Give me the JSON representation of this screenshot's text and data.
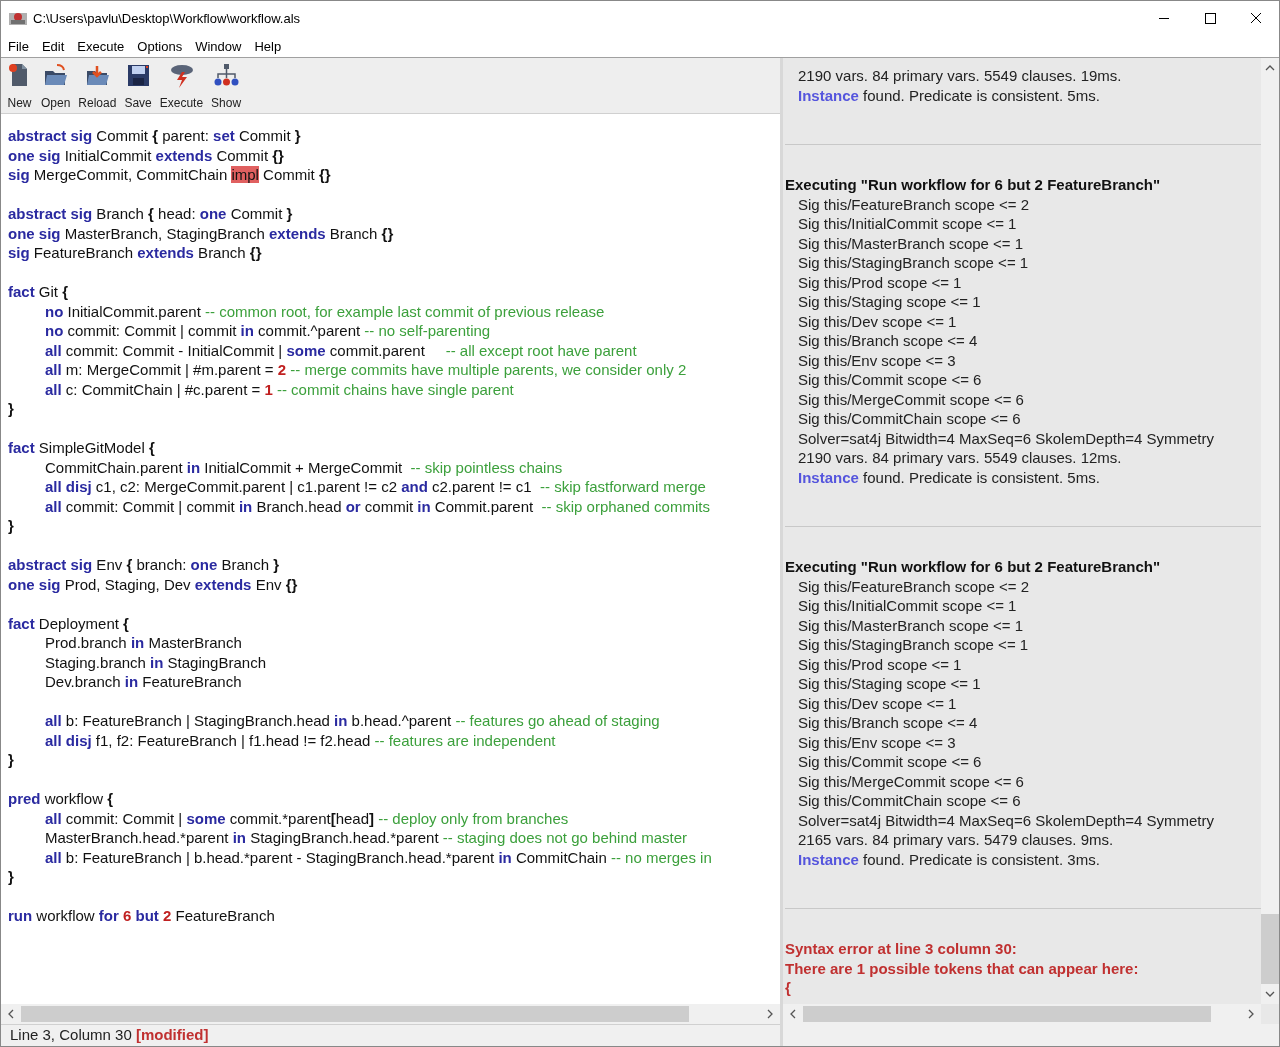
{
  "window": {
    "title": "C:\\Users\\pavlu\\Desktop\\Workflow\\workflow.als"
  },
  "menu": [
    {
      "label": "File"
    },
    {
      "label": "Edit"
    },
    {
      "label": "Execute"
    },
    {
      "label": "Options"
    },
    {
      "label": "Window"
    },
    {
      "label": "Help"
    }
  ],
  "toolbar": [
    {
      "label": "New",
      "kind": "new"
    },
    {
      "label": "Open",
      "kind": "open"
    },
    {
      "label": "Reload",
      "kind": "reload"
    },
    {
      "label": "Save",
      "kind": "save"
    },
    {
      "label": "Execute",
      "kind": "execute"
    },
    {
      "label": "Show",
      "kind": "show"
    }
  ],
  "editor": {
    "blocks": [
      [
        {
          "indented": false,
          "tokens": [
            {
              "text": "abstract sig",
              "kind": "kw"
            },
            {
              "text": " Commit ",
              "kind": "id"
            },
            {
              "text": "{",
              "kind": "brace"
            },
            {
              "text": " parent: ",
              "kind": "id"
            },
            {
              "text": "set",
              "kind": "kw"
            },
            {
              "text": " Commit ",
              "kind": "id"
            },
            {
              "text": "}",
              "kind": "brace"
            }
          ]
        },
        {
          "indented": false,
          "tokens": [
            {
              "text": "one sig",
              "kind": "kw"
            },
            {
              "text": " InitialCommit ",
              "kind": "id"
            },
            {
              "text": "extends",
              "kind": "kw"
            },
            {
              "text": " Commit ",
              "kind": "id"
            },
            {
              "text": "{}",
              "kind": "brace"
            }
          ]
        },
        {
          "indented": false,
          "tokens": [
            {
              "text": "sig",
              "kind": "kw"
            },
            {
              "text": " MergeCommit, CommitChain ",
              "kind": "id"
            },
            {
              "text": "impl",
              "kind": "error"
            },
            {
              "text": " Commit ",
              "kind": "id"
            },
            {
              "text": "{}",
              "kind": "brace"
            }
          ]
        }
      ],
      [
        {
          "indented": false,
          "tokens": [
            {
              "text": "abstract sig",
              "kind": "kw"
            },
            {
              "text": " Branch ",
              "kind": "id"
            },
            {
              "text": "{",
              "kind": "brace"
            },
            {
              "text": " head: ",
              "kind": "id"
            },
            {
              "text": "one",
              "kind": "kw"
            },
            {
              "text": " Commit ",
              "kind": "id"
            },
            {
              "text": "}",
              "kind": "brace"
            }
          ]
        },
        {
          "indented": false,
          "tokens": [
            {
              "text": "one sig",
              "kind": "kw"
            },
            {
              "text": " MasterBranch, StagingBranch ",
              "kind": "id"
            },
            {
              "text": "extends",
              "kind": "kw"
            },
            {
              "text": " Branch ",
              "kind": "id"
            },
            {
              "text": "{}",
              "kind": "brace"
            }
          ]
        },
        {
          "indented": false,
          "tokens": [
            {
              "text": "sig",
              "kind": "kw"
            },
            {
              "text": " FeatureBranch ",
              "kind": "id"
            },
            {
              "text": "extends",
              "kind": "kw"
            },
            {
              "text": " Branch ",
              "kind": "id"
            },
            {
              "text": "{}",
              "kind": "brace"
            }
          ]
        }
      ],
      [
        {
          "indented": false,
          "tokens": [
            {
              "text": "fact",
              "kind": "kw"
            },
            {
              "text": " Git ",
              "kind": "id"
            },
            {
              "text": "{",
              "kind": "brace"
            }
          ]
        },
        {
          "indented": true,
          "tokens": [
            {
              "text": "no",
              "kind": "kw"
            },
            {
              "text": " InitialCommit.parent ",
              "kind": "id"
            },
            {
              "text": "-- common root, for example last commit of previous release",
              "kind": "comment"
            }
          ]
        },
        {
          "indented": true,
          "tokens": [
            {
              "text": "no",
              "kind": "kw"
            },
            {
              "text": " commit: Commit | commit ",
              "kind": "id"
            },
            {
              "text": "in",
              "kind": "kw"
            },
            {
              "text": " commit.^parent ",
              "kind": "id"
            },
            {
              "text": "-- no self-parenting",
              "kind": "comment"
            }
          ]
        },
        {
          "indented": true,
          "tokens": [
            {
              "text": "all",
              "kind": "kw"
            },
            {
              "text": " commit: Commit - InitialCommit | ",
              "kind": "id"
            },
            {
              "text": "some",
              "kind": "kw"
            },
            {
              "text": " commit.parent     ",
              "kind": "id"
            },
            {
              "text": "-- all except root have parent",
              "kind": "comment"
            }
          ]
        },
        {
          "indented": true,
          "tokens": [
            {
              "text": "all",
              "kind": "kw"
            },
            {
              "text": " m: MergeCommit | #m.parent = ",
              "kind": "id"
            },
            {
              "text": "2",
              "kind": "num"
            },
            {
              "text": " -- merge commits have multiple parents, we consider only 2",
              "kind": "comment"
            }
          ]
        },
        {
          "indented": true,
          "tokens": [
            {
              "text": "all",
              "kind": "kw"
            },
            {
              "text": " c: CommitChain | #c.parent = ",
              "kind": "id"
            },
            {
              "text": "1",
              "kind": "num"
            },
            {
              "text": " -- commit chains have single parent",
              "kind": "comment"
            }
          ]
        },
        {
          "indented": false,
          "tokens": [
            {
              "text": "}",
              "kind": "brace"
            }
          ]
        }
      ],
      [
        {
          "indented": false,
          "tokens": [
            {
              "text": "fact",
              "kind": "kw"
            },
            {
              "text": " SimpleGitModel ",
              "kind": "id"
            },
            {
              "text": "{",
              "kind": "brace"
            }
          ]
        },
        {
          "indented": true,
          "tokens": [
            {
              "text": "CommitChain.parent ",
              "kind": "id"
            },
            {
              "text": "in",
              "kind": "kw"
            },
            {
              "text": " InitialCommit + MergeCommit  ",
              "kind": "id"
            },
            {
              "text": "-- skip pointless chains",
              "kind": "comment"
            }
          ]
        },
        {
          "indented": true,
          "tokens": [
            {
              "text": "all disj",
              "kind": "kw"
            },
            {
              "text": " c1, c2: MergeCommit.parent | c1.parent != c2 ",
              "kind": "id"
            },
            {
              "text": "and",
              "kind": "kw"
            },
            {
              "text": " c2.parent != c1  ",
              "kind": "id"
            },
            {
              "text": "-- skip fastforward merge",
              "kind": "comment"
            }
          ]
        },
        {
          "indented": true,
          "tokens": [
            {
              "text": "all",
              "kind": "kw"
            },
            {
              "text": " commit: Commit | commit ",
              "kind": "id"
            },
            {
              "text": "in",
              "kind": "kw"
            },
            {
              "text": " Branch.head ",
              "kind": "id"
            },
            {
              "text": "or",
              "kind": "kw"
            },
            {
              "text": " commit ",
              "kind": "id"
            },
            {
              "text": "in",
              "kind": "kw"
            },
            {
              "text": " Commit.parent  ",
              "kind": "id"
            },
            {
              "text": "-- skip orphaned commits",
              "kind": "comment"
            }
          ]
        },
        {
          "indented": false,
          "tokens": [
            {
              "text": "}",
              "kind": "brace"
            }
          ]
        }
      ],
      [
        {
          "indented": false,
          "tokens": [
            {
              "text": "abstract sig",
              "kind": "kw"
            },
            {
              "text": " Env ",
              "kind": "id"
            },
            {
              "text": "{",
              "kind": "brace"
            },
            {
              "text": " branch: ",
              "kind": "id"
            },
            {
              "text": "one",
              "kind": "kw"
            },
            {
              "text": " Branch ",
              "kind": "id"
            },
            {
              "text": "}",
              "kind": "brace"
            }
          ]
        },
        {
          "indented": false,
          "tokens": [
            {
              "text": "one sig",
              "kind": "kw"
            },
            {
              "text": " Prod, Staging, Dev ",
              "kind": "id"
            },
            {
              "text": "extends",
              "kind": "kw"
            },
            {
              "text": " Env ",
              "kind": "id"
            },
            {
              "text": "{}",
              "kind": "brace"
            }
          ]
        }
      ],
      [
        {
          "indented": false,
          "tokens": [
            {
              "text": "fact",
              "kind": "kw"
            },
            {
              "text": " Deployment ",
              "kind": "id"
            },
            {
              "text": "{",
              "kind": "brace"
            }
          ]
        },
        {
          "indented": true,
          "tokens": [
            {
              "text": "Prod.branch ",
              "kind": "id"
            },
            {
              "text": "in",
              "kind": "kw"
            },
            {
              "text": " MasterBranch",
              "kind": "id"
            }
          ]
        },
        {
          "indented": true,
          "tokens": [
            {
              "text": "Staging.branch ",
              "kind": "id"
            },
            {
              "text": "in",
              "kind": "kw"
            },
            {
              "text": " StagingBranch",
              "kind": "id"
            }
          ]
        },
        {
          "indented": true,
          "tokens": [
            {
              "text": "Dev.branch ",
              "kind": "id"
            },
            {
              "text": "in",
              "kind": "kw"
            },
            {
              "text": " FeatureBranch",
              "kind": "id"
            }
          ]
        }
      ],
      [
        {
          "indented": true,
          "tokens": [
            {
              "text": "all",
              "kind": "kw"
            },
            {
              "text": " b: FeatureBranch | StagingBranch.head ",
              "kind": "id"
            },
            {
              "text": "in",
              "kind": "kw"
            },
            {
              "text": " b.head.^parent ",
              "kind": "id"
            },
            {
              "text": "-- features go ahead of staging",
              "kind": "comment"
            }
          ]
        },
        {
          "indented": true,
          "tokens": [
            {
              "text": "all disj",
              "kind": "kw"
            },
            {
              "text": " f1, f2: FeatureBranch | f1.head != f2.head ",
              "kind": "id"
            },
            {
              "text": "-- features are independent",
              "kind": "comment"
            }
          ]
        },
        {
          "indented": false,
          "tokens": [
            {
              "text": "}",
              "kind": "brace"
            }
          ]
        }
      ],
      [
        {
          "indented": false,
          "tokens": [
            {
              "text": "pred",
              "kind": "kw"
            },
            {
              "text": " workflow ",
              "kind": "id"
            },
            {
              "text": "{",
              "kind": "brace"
            }
          ]
        },
        {
          "indented": true,
          "tokens": [
            {
              "text": "all",
              "kind": "kw"
            },
            {
              "text": " commit: Commit | ",
              "kind": "id"
            },
            {
              "text": "some",
              "kind": "kw"
            },
            {
              "text": " commit.*parent",
              "kind": "id"
            },
            {
              "text": "[",
              "kind": "brace"
            },
            {
              "text": "head",
              "kind": "id"
            },
            {
              "text": "]",
              "kind": "brace"
            },
            {
              "text": " -- deploy only from branches",
              "kind": "comment"
            }
          ]
        },
        {
          "indented": true,
          "tokens": [
            {
              "text": "MasterBranch.head.*parent ",
              "kind": "id"
            },
            {
              "text": "in",
              "kind": "kw"
            },
            {
              "text": " StagingBranch.head.*parent ",
              "kind": "id"
            },
            {
              "text": "-- staging does not go behind master",
              "kind": "comment"
            }
          ]
        },
        {
          "indented": true,
          "tokens": [
            {
              "text": "all",
              "kind": "kw"
            },
            {
              "text": " b: FeatureBranch | b.head.*parent - StagingBranch.head.*parent ",
              "kind": "id"
            },
            {
              "text": "in",
              "kind": "kw"
            },
            {
              "text": " CommitChain ",
              "kind": "id"
            },
            {
              "text": "-- no merges in",
              "kind": "comment"
            }
          ]
        },
        {
          "indented": false,
          "tokens": [
            {
              "text": "}",
              "kind": "brace"
            }
          ]
        }
      ],
      [
        {
          "indented": false,
          "tokens": [
            {
              "text": "run",
              "kind": "kw"
            },
            {
              "text": " workflow ",
              "kind": "id"
            },
            {
              "text": "for ",
              "kind": "kw"
            },
            {
              "text": "6 ",
              "kind": "num"
            },
            {
              "text": "but ",
              "kind": "kw"
            },
            {
              "text": "2",
              "kind": "num"
            },
            {
              "text": " FeatureBranch",
              "kind": "id"
            }
          ]
        }
      ]
    ]
  },
  "status_bar": {
    "position": "Line 3, Column 30",
    "flag": "[modified]"
  },
  "log": {
    "sections": [
      {
        "lines": [
          {
            "kind": "info",
            "text": "2190 vars. 84 primary vars. 5549 clauses. 19ms."
          },
          {
            "kind": "result",
            "keyword": "Instance",
            "text": " found. Predicate is consistent. 5ms."
          }
        ]
      },
      {
        "lines": [
          {
            "kind": "header",
            "text": "Executing \"Run workflow for 6 but 2 FeatureBranch\""
          },
          {
            "kind": "info",
            "text": "Sig this/FeatureBranch scope <= 2"
          },
          {
            "kind": "info",
            "text": "Sig this/InitialCommit scope <= 1"
          },
          {
            "kind": "info",
            "text": "Sig this/MasterBranch scope <= 1"
          },
          {
            "kind": "info",
            "text": "Sig this/StagingBranch scope <= 1"
          },
          {
            "kind": "info",
            "text": "Sig this/Prod scope <= 1"
          },
          {
            "kind": "info",
            "text": "Sig this/Staging scope <= 1"
          },
          {
            "kind": "info",
            "text": "Sig this/Dev scope <= 1"
          },
          {
            "kind": "info",
            "text": "Sig this/Branch scope <= 4"
          },
          {
            "kind": "info",
            "text": "Sig this/Env scope <= 3"
          },
          {
            "kind": "info",
            "text": "Sig this/Commit scope <= 6"
          },
          {
            "kind": "info",
            "text": "Sig this/MergeCommit scope <= 6"
          },
          {
            "kind": "info",
            "text": "Sig this/CommitChain scope <= 6"
          },
          {
            "kind": "info",
            "text": "Solver=sat4j Bitwidth=4 MaxSeq=6 SkolemDepth=4 Symmetry"
          },
          {
            "kind": "info",
            "text": "2190 vars. 84 primary vars. 5549 clauses. 12ms."
          },
          {
            "kind": "result",
            "keyword": "Instance",
            "text": " found. Predicate is consistent. 5ms."
          }
        ]
      },
      {
        "lines": [
          {
            "kind": "header",
            "text": "Executing \"Run workflow for 6 but 2 FeatureBranch\""
          },
          {
            "kind": "info",
            "text": "Sig this/FeatureBranch scope <= 2"
          },
          {
            "kind": "info",
            "text": "Sig this/InitialCommit scope <= 1"
          },
          {
            "kind": "info",
            "text": "Sig this/MasterBranch scope <= 1"
          },
          {
            "kind": "info",
            "text": "Sig this/StagingBranch scope <= 1"
          },
          {
            "kind": "info",
            "text": "Sig this/Prod scope <= 1"
          },
          {
            "kind": "info",
            "text": "Sig this/Staging scope <= 1"
          },
          {
            "kind": "info",
            "text": "Sig this/Dev scope <= 1"
          },
          {
            "kind": "info",
            "text": "Sig this/Branch scope <= 4"
          },
          {
            "kind": "info",
            "text": "Sig this/Env scope <= 3"
          },
          {
            "kind": "info",
            "text": "Sig this/Commit scope <= 6"
          },
          {
            "kind": "info",
            "text": "Sig this/MergeCommit scope <= 6"
          },
          {
            "kind": "info",
            "text": "Sig this/CommitChain scope <= 6"
          },
          {
            "kind": "info",
            "text": "Solver=sat4j Bitwidth=4 MaxSeq=6 SkolemDepth=4 Symmetry"
          },
          {
            "kind": "info",
            "text": "2165 vars. 84 primary vars. 5479 clauses. 9ms."
          },
          {
            "kind": "result",
            "keyword": "Instance",
            "text": " found. Predicate is consistent. 3ms."
          }
        ]
      },
      {
        "lines": [
          {
            "kind": "error",
            "text": "Syntax error at line 3 column 30:"
          },
          {
            "kind": "error",
            "text": "There are 1 possible tokens that can appear here:"
          },
          {
            "kind": "error",
            "text": "{"
          }
        ]
      }
    ]
  }
}
